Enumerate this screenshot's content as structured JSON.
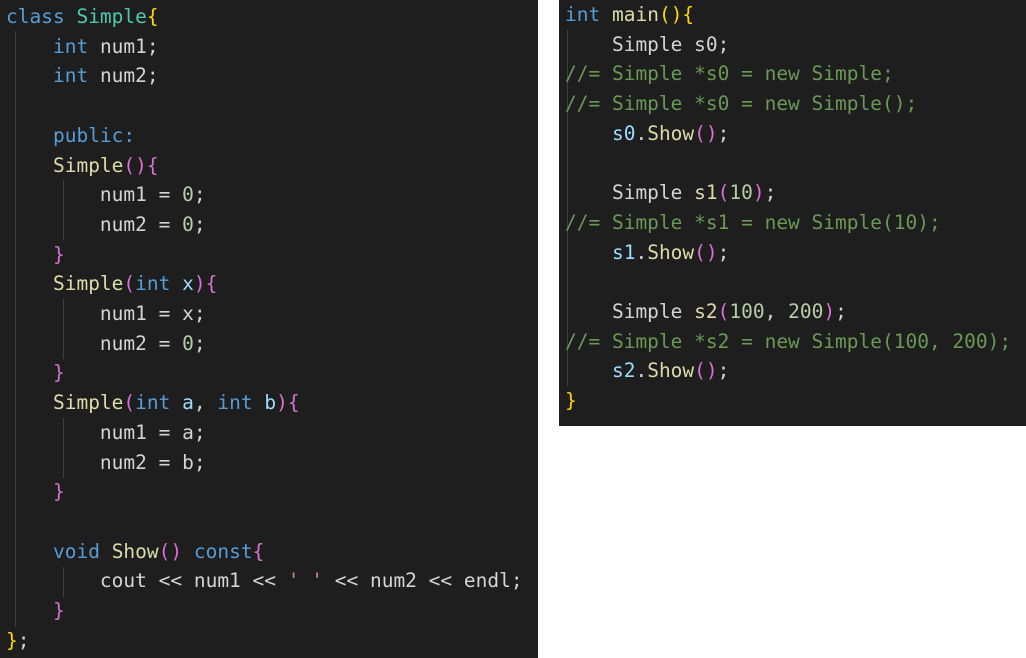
{
  "left_code": [
    [
      [
        "class ",
        "kw"
      ],
      [
        "Simple",
        "ty"
      ],
      [
        "{",
        "b1"
      ]
    ],
    [
      [
        "    ",
        "pl"
      ],
      [
        "int",
        "kw"
      ],
      [
        " num1;",
        "pl"
      ]
    ],
    [
      [
        "    ",
        "pl"
      ],
      [
        "int",
        "kw"
      ],
      [
        " num2;",
        "pl"
      ]
    ],
    [],
    [
      [
        "    ",
        "pl"
      ],
      [
        "public:",
        "kw"
      ]
    ],
    [
      [
        "    ",
        "pl"
      ],
      [
        "Simple",
        "fn"
      ],
      [
        "(){",
        "b2"
      ]
    ],
    [
      [
        "        num1 = ",
        "pl"
      ],
      [
        "0",
        "nu"
      ],
      [
        ";",
        "pl"
      ]
    ],
    [
      [
        "        num2 = ",
        "pl"
      ],
      [
        "0",
        "nu"
      ],
      [
        ";",
        "pl"
      ]
    ],
    [
      [
        "    ",
        "pl"
      ],
      [
        "}",
        "b2"
      ]
    ],
    [
      [
        "    ",
        "pl"
      ],
      [
        "Simple",
        "fn"
      ],
      [
        "(",
        "b2"
      ],
      [
        "int",
        "kw"
      ],
      [
        " ",
        "pl"
      ],
      [
        "x",
        "va"
      ],
      [
        "){",
        "b2"
      ]
    ],
    [
      [
        "        num1 = x;",
        "pl"
      ]
    ],
    [
      [
        "        num2 = ",
        "pl"
      ],
      [
        "0",
        "nu"
      ],
      [
        ";",
        "pl"
      ]
    ],
    [
      [
        "    ",
        "pl"
      ],
      [
        "}",
        "b2"
      ]
    ],
    [
      [
        "    ",
        "pl"
      ],
      [
        "Simple",
        "fn"
      ],
      [
        "(",
        "b2"
      ],
      [
        "int",
        "kw"
      ],
      [
        " ",
        "pl"
      ],
      [
        "a",
        "va"
      ],
      [
        ", ",
        "pl"
      ],
      [
        "int",
        "kw"
      ],
      [
        " ",
        "pl"
      ],
      [
        "b",
        "va"
      ],
      [
        "){",
        "b2"
      ]
    ],
    [
      [
        "        num1 = a;",
        "pl"
      ]
    ],
    [
      [
        "        num2 = b;",
        "pl"
      ]
    ],
    [
      [
        "    ",
        "pl"
      ],
      [
        "}",
        "b2"
      ]
    ],
    [],
    [
      [
        "    ",
        "pl"
      ],
      [
        "void",
        "kw"
      ],
      [
        " ",
        "pl"
      ],
      [
        "Show",
        "fn"
      ],
      [
        "()",
        "b2"
      ],
      [
        " ",
        "pl"
      ],
      [
        "const",
        "kw"
      ],
      [
        "{",
        "b2"
      ]
    ],
    [
      [
        "        cout << num1 << ",
        "pl"
      ],
      [
        "' '",
        "st"
      ],
      [
        " << num2 << endl;",
        "pl"
      ]
    ],
    [
      [
        "    ",
        "pl"
      ],
      [
        "}",
        "b2"
      ]
    ],
    [
      [
        "}",
        "b1"
      ],
      [
        ";",
        "pl"
      ]
    ]
  ],
  "right_code": [
    [
      [
        "int",
        "kw"
      ],
      [
        " ",
        "pl"
      ],
      [
        "main",
        "fn"
      ],
      [
        "(){",
        "b1"
      ]
    ],
    [
      [
        "    Simple s0;",
        "pl"
      ]
    ],
    [
      [
        "//= Simple *s0 = new Simple;",
        "cm"
      ]
    ],
    [
      [
        "//= Simple *s0 = new Simple();",
        "cm"
      ]
    ],
    [
      [
        "    ",
        "pl"
      ],
      [
        "s0",
        "va"
      ],
      [
        ".",
        "pl"
      ],
      [
        "Show",
        "fn"
      ],
      [
        "()",
        "b2"
      ],
      [
        ";",
        "pl"
      ]
    ],
    [],
    [
      [
        "    Simple ",
        "pl"
      ],
      [
        "s1",
        "fn"
      ],
      [
        "(",
        "b2"
      ],
      [
        "10",
        "nu"
      ],
      [
        ")",
        "b2"
      ],
      [
        ";",
        "pl"
      ]
    ],
    [
      [
        "//= Simple *s1 = new Simple(10);",
        "cm"
      ]
    ],
    [
      [
        "    ",
        "pl"
      ],
      [
        "s1",
        "va"
      ],
      [
        ".",
        "pl"
      ],
      [
        "Show",
        "fn"
      ],
      [
        "()",
        "b2"
      ],
      [
        ";",
        "pl"
      ]
    ],
    [],
    [
      [
        "    Simple ",
        "pl"
      ],
      [
        "s2",
        "fn"
      ],
      [
        "(",
        "b2"
      ],
      [
        "100",
        "nu"
      ],
      [
        ", ",
        "pl"
      ],
      [
        "200",
        "nu"
      ],
      [
        ")",
        "b2"
      ],
      [
        ";",
        "pl"
      ]
    ],
    [
      [
        "//= Simple *s2 = new Simple(100, 200);",
        "cm"
      ]
    ],
    [
      [
        "    ",
        "pl"
      ],
      [
        "s2",
        "va"
      ],
      [
        ".",
        "pl"
      ],
      [
        "Show",
        "fn"
      ],
      [
        "()",
        "b2"
      ],
      [
        ";",
        "pl"
      ]
    ],
    [
      [
        "}",
        "b1"
      ]
    ]
  ]
}
